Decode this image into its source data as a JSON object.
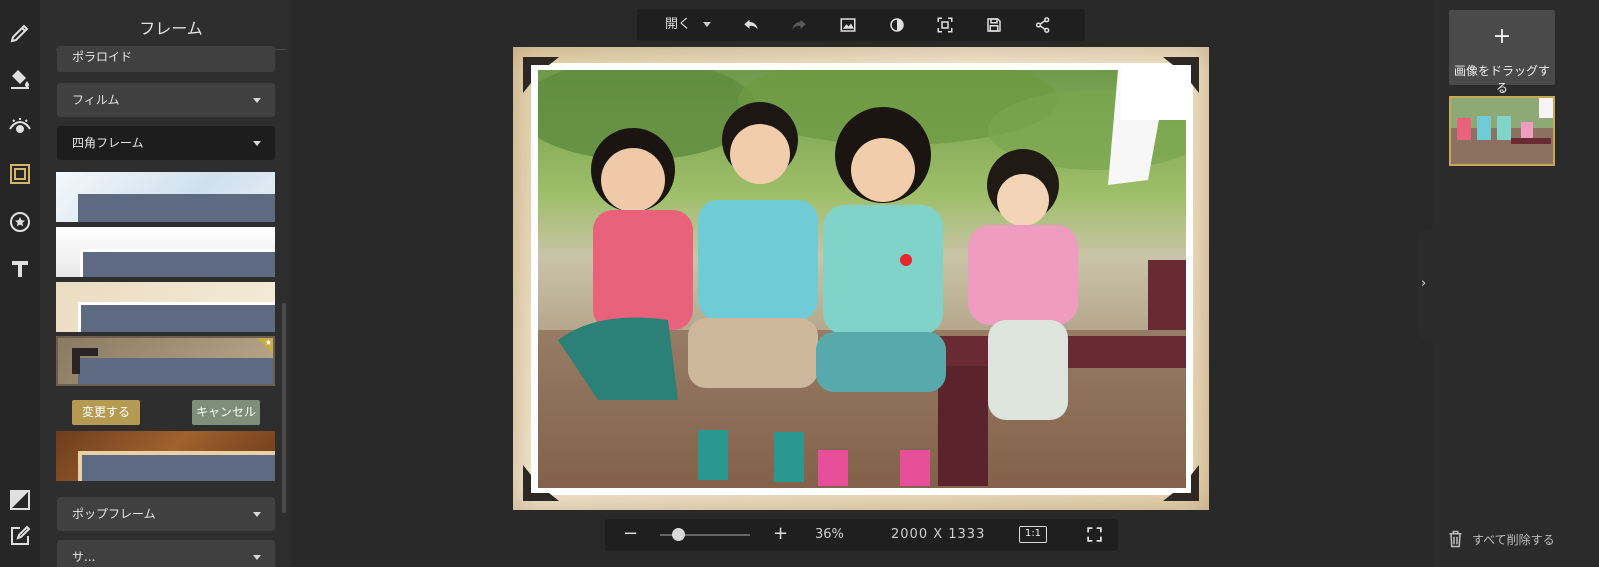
{
  "left_rail": {
    "tools": [
      {
        "name": "pencil-icon",
        "active": false
      },
      {
        "name": "paint-bucket-icon",
        "active": false
      },
      {
        "name": "eye-icon",
        "active": false
      },
      {
        "name": "frame-icon",
        "active": true
      },
      {
        "name": "star-badge-icon",
        "active": false
      },
      {
        "name": "text-icon",
        "active": false
      }
    ],
    "bottom_tools": [
      "contrast-square-icon",
      "edit-note-icon"
    ]
  },
  "frame_panel": {
    "title": "フレーム",
    "dropdowns": {
      "polaroid": "ポラロイド",
      "film": "フィルム",
      "square_frame": "四角フレーム",
      "pop_frame": "ポップフレーム",
      "partial": "サ..."
    },
    "change_button": "変更する",
    "cancel_button": "キャンセル"
  },
  "toolbar": {
    "open_label": "開く",
    "icons": [
      "undo-icon",
      "redo-icon",
      "image-icon",
      "contrast-icon",
      "fit-screen-icon",
      "save-icon",
      "share-icon"
    ]
  },
  "zoom": {
    "minus": "−",
    "plus": "+",
    "percent": "36%",
    "dimensions": "2000 X 1333",
    "one_to_one": "1:1",
    "slider_level": 0.2
  },
  "right_panel": {
    "add_plus": "+",
    "drag_label": "画像をドラッグする",
    "toggle_glyph": "›",
    "clear_all": "すべて削除する"
  },
  "colors": {
    "accent": "#d6b668",
    "change_button": "#b59a52",
    "cancel_button": "#7d8f78"
  }
}
